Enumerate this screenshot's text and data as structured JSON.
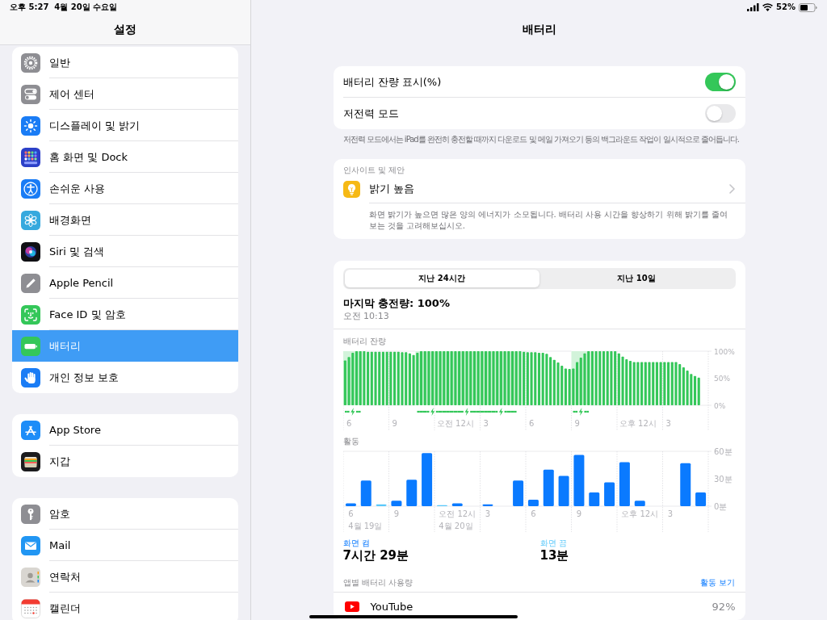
{
  "status_bar": {
    "time": "오후 5:27",
    "date": "4월 20일 수요일",
    "battery": "52%"
  },
  "sidebar": {
    "title": "설정",
    "groups": [
      {
        "items": [
          {
            "label": "일반",
            "selected": false
          },
          {
            "label": "제어 센터",
            "selected": false
          },
          {
            "label": "디스플레이 및 밝기",
            "selected": false
          },
          {
            "label": "홈 화면 및 Dock",
            "selected": false
          },
          {
            "label": "손쉬운 사용",
            "selected": false
          },
          {
            "label": "배경화면",
            "selected": false
          },
          {
            "label": "Siri 및 검색",
            "selected": false
          },
          {
            "label": "Apple Pencil",
            "selected": false
          },
          {
            "label": "Face ID 및 암호",
            "selected": false
          },
          {
            "label": "배터리",
            "selected": true
          },
          {
            "label": "개인 정보 보호",
            "selected": false
          }
        ]
      },
      {
        "items": [
          {
            "label": "App Store",
            "selected": false
          },
          {
            "label": "지갑",
            "selected": false
          }
        ]
      },
      {
        "items": [
          {
            "label": "암호",
            "selected": false
          },
          {
            "label": "Mail",
            "selected": false
          },
          {
            "label": "연락처",
            "selected": false
          },
          {
            "label": "캘린더",
            "selected": false
          }
        ]
      }
    ]
  },
  "detail": {
    "title": "배터리",
    "settings": [
      {
        "label": "배터리 잔량 표시(%)",
        "on": true
      },
      {
        "label": "저전력 모드",
        "on": false
      }
    ],
    "settings_footer": "저전력 모드에서는 iPad를 완전히 충전할 때까지 다운로드 및 메일 가져오기 등의 백그라운드 작업이 일시적으로 줄어듭니다.",
    "insights": {
      "header": "인사이트 및 제안",
      "title": "밝기 높음",
      "description": "화면 밝기가 높으면 많은 양의 에너지가 소모됩니다. 배터리 사용 시간을 향상하기 위해 밝기를 줄여보는 것을 고려해보십시오."
    },
    "usage": {
      "tabs": [
        {
          "label": "지난 24시간",
          "selected": true
        },
        {
          "label": "지난 10일",
          "selected": false
        }
      ],
      "last_charge": "마지막 충전량: 100%",
      "last_charge_time": "오전 10:13",
      "battery_chart": {
        "chart_data": {
          "type": "bar",
          "title": "배터리 잔량",
          "categories": [
            null,
            "6",
            null,
            null,
            null,
            null,
            null,
            null,
            null,
            null,
            null,
            null,
            null,
            "9",
            null,
            null,
            null,
            null,
            null,
            null,
            null,
            null,
            null,
            null,
            null,
            null,
            null,
            null,
            null,
            "오전 12시",
            null,
            null,
            null,
            null,
            null,
            null,
            null,
            "3",
            null,
            null,
            null,
            null,
            null,
            null,
            null,
            null,
            null,
            null,
            null,
            "6",
            null,
            null,
            null,
            null,
            null,
            null,
            null,
            null,
            null,
            null,
            null,
            "9",
            null,
            null,
            null,
            null,
            null,
            null,
            null,
            null,
            null,
            null,
            null,
            null,
            null,
            null,
            null,
            "오후 12시",
            null,
            null,
            null,
            null,
            null,
            null,
            null,
            "3",
            null,
            null,
            null,
            null,
            null,
            null,
            null,
            null,
            null,
            null
          ],
          "series": [
            {
              "color": "#34c759",
              "values": [
                83,
                89,
                97,
                100,
                100,
                100,
                99,
                99,
                99,
                99,
                99,
                99,
                99,
                99,
                99,
                98,
                98,
                96,
                93,
                97,
                100,
                100,
                100,
                100,
                100,
                100,
                100,
                100,
                100,
                100,
                100,
                100,
                100,
                100,
                100,
                100,
                100,
                100,
                100,
                100,
                100,
                100,
                100,
                100,
                100,
                100,
                100,
                99,
                98,
                98,
                98,
                97,
                97,
                95,
                89,
                84,
                79,
                73,
                68,
                67,
                68,
                80,
                88,
                96,
                100,
                100,
                100,
                100,
                100,
                100,
                100,
                100,
                96,
                90,
                85,
                82,
                80,
                80,
                80,
                80,
                80,
                80,
                80,
                80,
                80,
                80,
                80,
                80,
                76,
                70,
                64,
                58,
                54,
                51,
                null,
                null
              ]
            }
          ],
          "ylim": [
            0,
            100
          ],
          "yticks": [
            {
              "value": 0,
              "label": "0%"
            },
            {
              "value": 50,
              "label": "50%"
            },
            {
              "value": 100,
              "label": "100%"
            }
          ]
        },
        "charging": [
          true,
          true,
          true,
          true,
          true,
          false,
          false,
          false,
          false,
          false,
          false,
          false,
          false,
          false,
          false,
          false,
          false,
          false,
          false,
          true,
          true,
          true,
          true,
          true,
          true,
          true,
          true,
          true,
          true,
          true,
          true,
          true,
          true,
          true,
          true,
          true,
          true,
          true,
          true,
          true,
          true,
          true,
          true,
          true,
          true,
          true,
          false,
          false,
          false,
          false,
          false,
          false,
          false,
          false,
          false,
          false,
          false,
          false,
          false,
          false,
          true,
          true,
          true,
          true,
          true,
          false,
          false,
          false,
          false,
          false,
          false,
          false,
          false,
          false,
          false,
          false,
          false,
          false,
          false,
          false,
          false,
          false,
          false,
          false,
          false,
          false,
          false,
          false,
          false,
          false,
          false,
          false,
          false,
          false
        ]
      },
      "activity_chart": {
        "chart_data": {
          "type": "bar",
          "title": "활동",
          "stacked": true,
          "categories": [
            "6",
            null,
            null,
            "9",
            null,
            null,
            null,
            "오전 12시",
            null,
            "3",
            null,
            null,
            "6",
            null,
            null,
            "9",
            null,
            null,
            null,
            "오후 12시",
            null,
            "3",
            null,
            null
          ],
          "series": [
            {
              "color": "#0a7aff",
              "values": [
                3,
                28,
                0,
                6,
                29,
                58,
                0,
                3,
                0,
                2,
                0,
                28,
                7,
                40,
                33,
                56,
                15,
                26,
                48,
                6,
                0,
                0,
                47,
                15
              ]
            },
            {
              "color": "#5ac8fa",
              "values": [
                0,
                0,
                2,
                0,
                0,
                0,
                1,
                0,
                0,
                0,
                0,
                0,
                0,
                0,
                0,
                0,
                0,
                0,
                0,
                0,
                0,
                0,
                0,
                0
              ]
            }
          ],
          "ylim": [
            0,
            60
          ],
          "yticks": [
            {
              "value": 0,
              "label": "0분"
            },
            {
              "value": 30,
              "label": "30분"
            },
            {
              "value": 60,
              "label": "60분"
            }
          ],
          "annotations": [
            "4월 19일",
            "4월 20일"
          ]
        }
      },
      "summary": [
        {
          "label": "화면 켬",
          "value": "7시간 29분"
        },
        {
          "label": "화면 끔",
          "value": "13분"
        }
      ],
      "apps_header": "앱별 배터리 사용량",
      "apps_link": "활동 보기",
      "apps": [
        {
          "name": "YouTube",
          "share": "92%"
        }
      ]
    }
  }
}
